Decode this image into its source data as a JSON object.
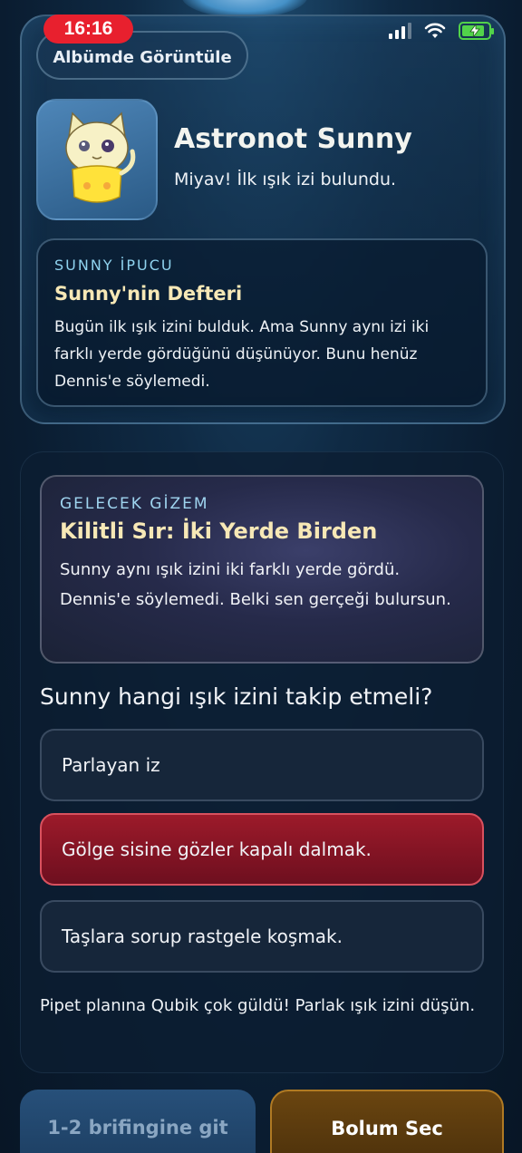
{
  "status_bar": {
    "time": "16:16"
  },
  "header": {
    "album_button_label": "Albümde Görüntüle"
  },
  "character": {
    "name": "Astronot Sunny",
    "line": "Miyav! İlk ışık izi bulundu."
  },
  "hint": {
    "eyebrow": "SUNNY İPUCU",
    "title": "Sunny'nin Defteri",
    "body": "Bugün ilk ışık izini bulduk. Ama Sunny aynı izi iki farklı yerde gördüğünü düşünüyor. Bunu henüz Dennis'e söylemedi."
  },
  "mystery": {
    "eyebrow": "GELECEK GİZEM",
    "title": "Kilitli Sır: İki Yerde Birden",
    "body": "Sunny aynı ışık izini iki farklı yerde gördü. Dennis'e söylemedi. Belki sen gerçeği bulursun."
  },
  "quiz": {
    "question": "Sunny hangi ışık izini takip etmeli?",
    "options": [
      {
        "label": "Parlayan iz",
        "selected": false
      },
      {
        "label": "Gölge sisine gözler kapalı dalmak.",
        "selected": true
      },
      {
        "label": "Taşlara sorup rastgele koşmak.",
        "selected": false
      }
    ],
    "feedback": "Pipet planına Qubik çok güldü! Parlak ışık izini düşün."
  },
  "footer": {
    "left_button": "1-2 brifingine git",
    "right_button": "Bolum Sec"
  },
  "colors": {
    "time_pill": "#e8202e",
    "accent_gold": "#f7e8b6",
    "accent_cyan": "#8fd3ef",
    "selected_option": "#9c1a2a",
    "battery": "#52d34a"
  }
}
